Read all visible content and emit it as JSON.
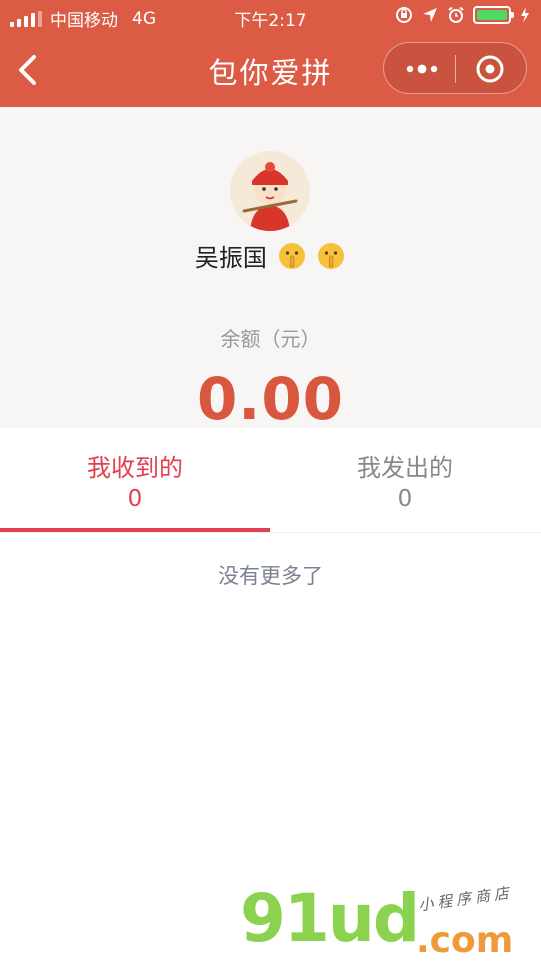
{
  "colors": {
    "header_bg": "#db5b44",
    "accent_red": "#e0404f",
    "amount_red": "#d9573f",
    "battery_green": "#4cd964"
  },
  "status_bar": {
    "carrier": "中国移动",
    "network": "4G",
    "time": "下午2:17",
    "icons": [
      "signal-icon",
      "orientation-lock-icon",
      "location-arrow-icon",
      "alarm-icon",
      "battery-icon",
      "charging-bolt-icon"
    ]
  },
  "nav": {
    "title": "包你爱拼",
    "back_icon": "chevron-left-icon",
    "menu_icon": "more-dots-icon",
    "close_icon": "target-circle-icon"
  },
  "profile": {
    "nickname": "吴振国",
    "emoji_icons": [
      "shushing-face-icon",
      "shushing-face-icon"
    ],
    "balance_label": "余额（元）",
    "balance_amount": "0.00"
  },
  "tabs": [
    {
      "label": "我收到的",
      "count": "0",
      "active": true
    },
    {
      "label": "我发出的",
      "count": "0",
      "active": false
    }
  ],
  "list": {
    "empty_text": "没有更多了"
  },
  "watermark": {
    "main": "91ud",
    "suffix": ".com",
    "tagline": "小程序商店"
  }
}
